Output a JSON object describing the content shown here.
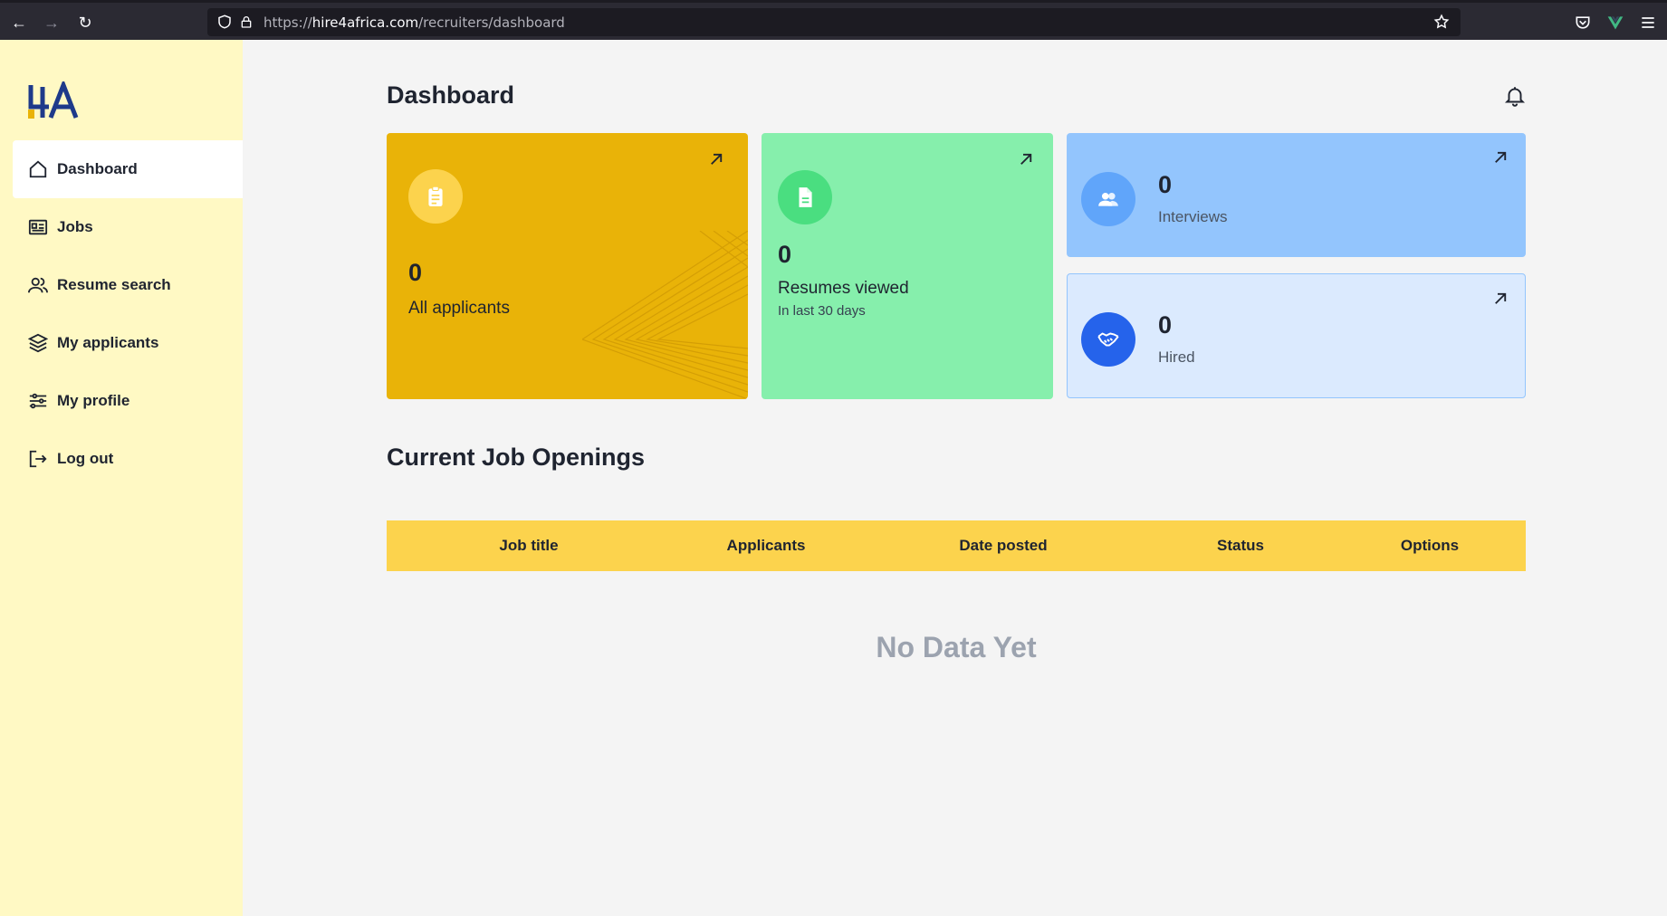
{
  "browser": {
    "url_prefix": "https://",
    "url_host": "hire4africa.com",
    "url_path": "/recruiters/dashboard"
  },
  "sidebar": {
    "logo_alt": "HA",
    "items": [
      {
        "label": "Dashboard",
        "icon": "home-icon",
        "active": true
      },
      {
        "label": "Jobs",
        "icon": "id-card-icon"
      },
      {
        "label": "Resume search",
        "icon": "users-icon"
      },
      {
        "label": "My applicants",
        "icon": "layers-icon"
      },
      {
        "label": "My profile",
        "icon": "sliders-icon"
      },
      {
        "label": "Log out",
        "icon": "logout-icon"
      }
    ]
  },
  "header": {
    "title": "Dashboard"
  },
  "stats": {
    "applicants": {
      "count": "0",
      "label": "All applicants"
    },
    "resumes": {
      "count": "0",
      "label": "Resumes viewed",
      "sublabel": "In last 30 days"
    },
    "interviews": {
      "count": "0",
      "label": "Interviews"
    },
    "hired": {
      "count": "0",
      "label": "Hired"
    }
  },
  "jobs": {
    "title": "Current Job Openings",
    "columns": [
      "Job title",
      "Applicants",
      "Date posted",
      "Status",
      "Options"
    ],
    "empty_text": "No Data Yet"
  },
  "colors": {
    "sidebar_bg": "#fff9c4",
    "applicants_card": "#e9b308",
    "resumes_card": "#86efac",
    "interviews_card": "#93c5fd",
    "hired_card": "#dbeafe",
    "table_header": "#fcd34d"
  }
}
